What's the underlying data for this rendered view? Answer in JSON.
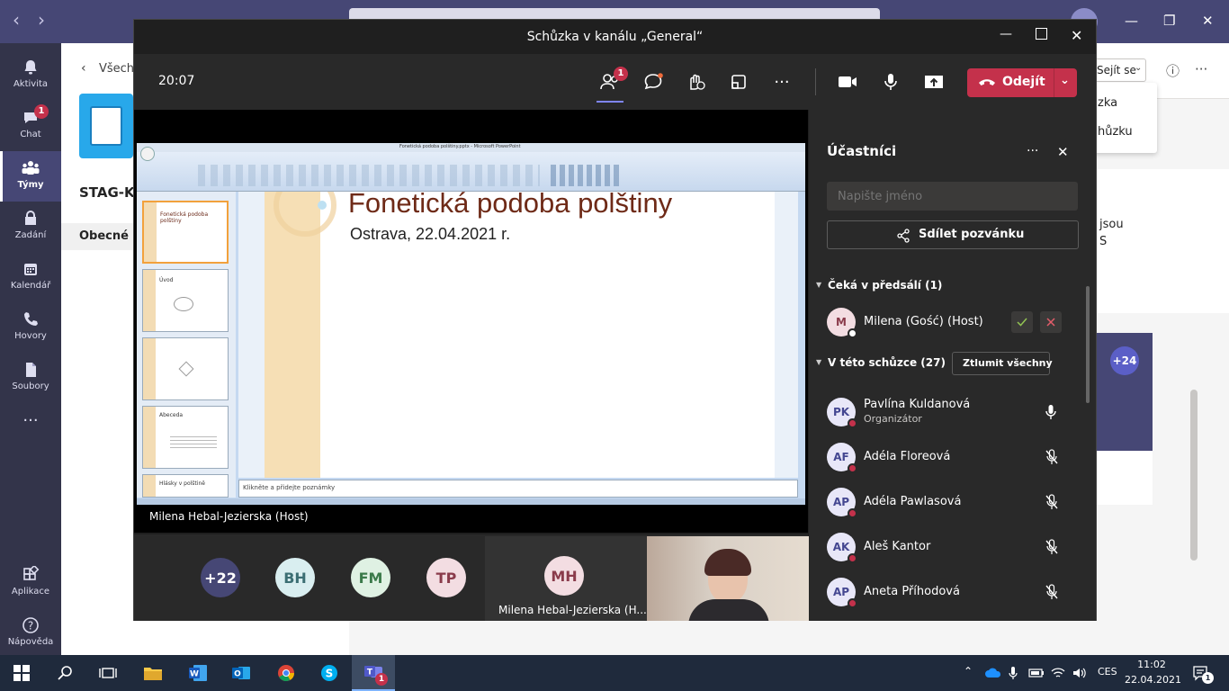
{
  "teams": {
    "rail": [
      {
        "label": "Aktivita",
        "icon": "bell-icon"
      },
      {
        "label": "Chat",
        "icon": "chat-icon",
        "badge": "1"
      },
      {
        "label": "Týmy",
        "icon": "teams-icon",
        "active": true
      },
      {
        "label": "Zadání",
        "icon": "assignments-icon"
      },
      {
        "label": "Kalendář",
        "icon": "calendar-icon"
      },
      {
        "label": "Hovory",
        "icon": "phone-icon"
      },
      {
        "label": "Soubory",
        "icon": "files-icon"
      },
      {
        "label": "Aplikace",
        "icon": "apps-icon"
      },
      {
        "label": "Nápověda",
        "icon": "help-icon"
      }
    ],
    "left_panel": {
      "back_label": "Všech",
      "team_name": "STAG-K",
      "channel": "Obecné"
    },
    "right_panel": {
      "join_label": "Sejít se",
      "menu_item_1": "zka",
      "menu_item_2": "hůzku",
      "text_1": "jsou",
      "text_2": "S",
      "more_count": "+24"
    }
  },
  "meeting": {
    "title": "Schůzka v kanálu „General“",
    "time": "20:07",
    "participants_badge": "1",
    "leave_label": "Odejít",
    "presenter": "Milena Hebal-Jezierska (Host)",
    "slide": {
      "title": "Fonetická podoba polštiny",
      "subtitle": "Ostrava, 22.04.2021 r.",
      "notes_hint": "Klikněte a přidejte poznámky",
      "window_title": "Fonetická podoba polštiny.pptx - Microsoft PowerPoint",
      "thumb_1": "Fonetická podoba polštiny",
      "thumb_2": "Úvod",
      "thumb_4": "Abeceda",
      "thumb_5": "Hlásky v polštině"
    },
    "tiles": [
      {
        "label": "+22",
        "bg": "#464775",
        "fg": "#ffffff"
      },
      {
        "label": "BH",
        "bg": "#d9eef0",
        "fg": "#3b6e73"
      },
      {
        "label": "FM",
        "bg": "#dff1e3",
        "fg": "#3b7a4a"
      },
      {
        "label": "TP",
        "bg": "#f3dde2",
        "fg": "#8a3b4b"
      },
      {
        "label": "MH",
        "bg": "#f3dde2",
        "fg": "#8a3b4b"
      }
    ],
    "mh_tile_name": "Milena Hebal-Jezierska (H..."
  },
  "people": {
    "title": "Účastníci",
    "search_placeholder": "Napište jméno",
    "share_label": "Sdílet pozvánku",
    "lobby_header": "Čeká v předsálí (1)",
    "lobby": [
      {
        "initials": "M",
        "name": "Milena (Gość) (Host)"
      }
    ],
    "in_meeting_header": "V této schůzce (27)",
    "mute_all_label": "Ztlumit všechny",
    "list": [
      {
        "initials": "PK",
        "name": "Pavlína Kuldanová",
        "role": "Organizátor"
      },
      {
        "initials": "AF",
        "name": "Adéla Floreová",
        "role": ""
      },
      {
        "initials": "AP",
        "name": "Adéla Pawlasová",
        "role": ""
      },
      {
        "initials": "AK",
        "name": "Aleš Kantor",
        "role": ""
      },
      {
        "initials": "AP",
        "name": "Aneta Příhodová",
        "role": ""
      }
    ]
  },
  "taskbar": {
    "lang": "CES",
    "time": "11:02",
    "date": "22.04.2021",
    "notif_count": "1",
    "teams_badge": "1"
  },
  "colors": {
    "teams_purple": "#464775",
    "leave_red": "#c4314b",
    "rail_bg": "#33344a",
    "meeting_bg": "#292929"
  }
}
